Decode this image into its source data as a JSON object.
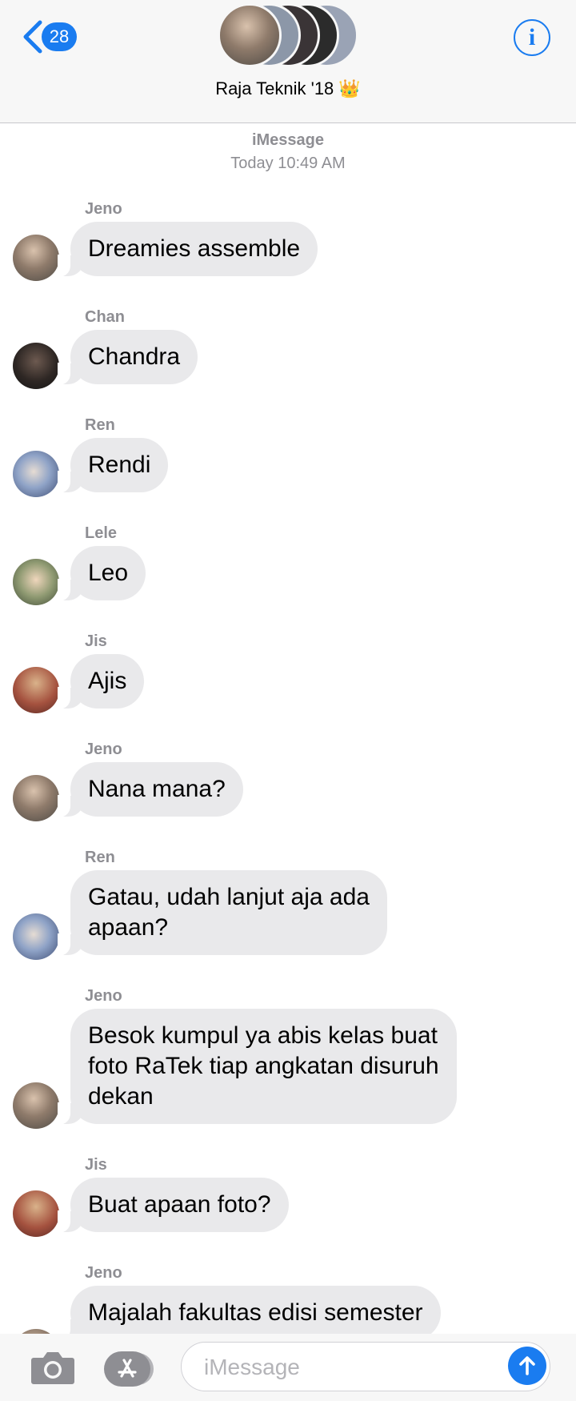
{
  "header": {
    "back_count": "28",
    "title": "Raja Teknik '18 👑",
    "colors": {
      "accent": "#1a7cf0",
      "bar": "#f7f7f7"
    },
    "icons": {
      "back": "chevron-left-icon",
      "info": "info-icon"
    }
  },
  "thread": {
    "service": "iMessage",
    "timestamp": "Today 10:49 AM",
    "messages": [
      {
        "sender": "Jeno",
        "text": "Dreamies assemble"
      },
      {
        "sender": "Chan",
        "text": "Chandra"
      },
      {
        "sender": "Ren",
        "text": "Rendi"
      },
      {
        "sender": "Lele",
        "text": "Leo"
      },
      {
        "sender": "Jis",
        "text": "Ajis"
      },
      {
        "sender": "Jeno",
        "text": "Nana mana?"
      },
      {
        "sender": "Ren",
        "text": "Gatau, udah lanjut aja ada\napaan?"
      },
      {
        "sender": "Jeno",
        "text": "Besok kumpul ya abis kelas buat\nfoto RaTek tiap angkatan disuruh\ndekan"
      },
      {
        "sender": "Jis",
        "text": "Buat apaan foto?"
      },
      {
        "sender": "Jeno",
        "text": "Majalah fakultas edisi semester"
      }
    ],
    "colors": {
      "bubble": "#e9e9eb",
      "meta": "#8e8e93"
    }
  },
  "input": {
    "placeholder": "iMessage",
    "icons": {
      "camera": "camera-icon",
      "apps": "app-store-icon",
      "send": "send-arrow-icon"
    }
  }
}
